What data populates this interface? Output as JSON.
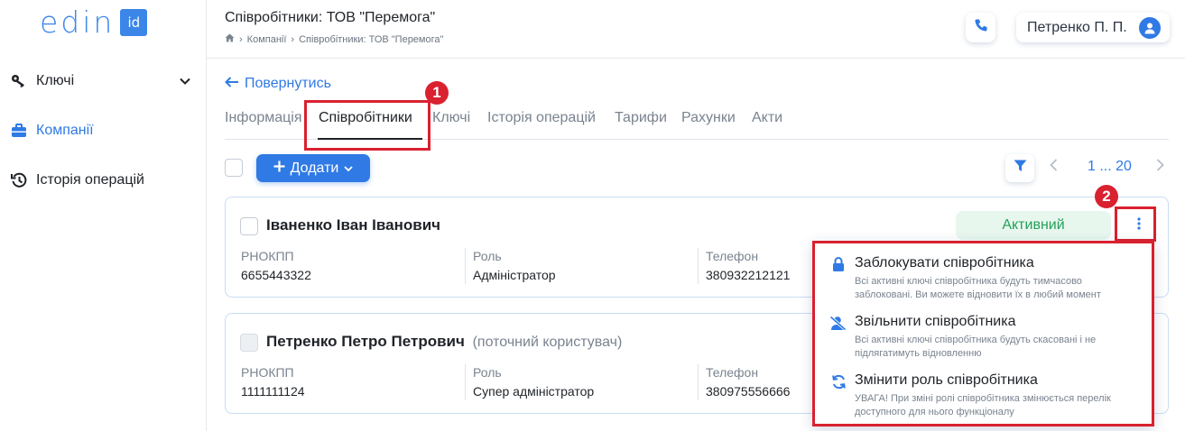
{
  "logo": {
    "text": "edin",
    "badge": "id"
  },
  "sidebar": {
    "items": [
      {
        "label": "Ключі",
        "icon": "key-icon"
      },
      {
        "label": "Компанії",
        "icon": "briefcase-icon"
      },
      {
        "label": "Історія операцій",
        "icon": "history-icon"
      }
    ]
  },
  "header": {
    "title": "Співробітники: ТОВ \"Перемога\"",
    "breadcrumb": [
      "Компанії",
      "Співробітники: ТОВ \"Перемога\""
    ],
    "user_name": "Петренко П. П."
  },
  "main": {
    "back_label": "Повернутись",
    "tabs": [
      "Інформація",
      "Співробітники",
      "Ключі",
      "Історія операцій",
      "Тарифи",
      "Рахунки",
      "Акти"
    ],
    "add_label": "Додати",
    "pager": "1 ... 20"
  },
  "employees": [
    {
      "name": "Іваненко Іван Іванович",
      "note": "",
      "status": "Активний",
      "fields": [
        {
          "label": "РНОКПП",
          "value": "6655443322"
        },
        {
          "label": "Роль",
          "value": "Адміністратор"
        },
        {
          "label": "Телефон",
          "value": "380932212121"
        }
      ]
    },
    {
      "name": "Петренко Петро Петрович",
      "note": "(поточний користувач)",
      "status": "",
      "fields": [
        {
          "label": "РНОКПП",
          "value": "1111111124"
        },
        {
          "label": "Роль",
          "value": "Супер адміністратор"
        },
        {
          "label": "Телефон",
          "value": "380975556666"
        }
      ]
    }
  ],
  "menu": {
    "items": [
      {
        "title": "Заблокувати співробітника",
        "desc": "Всі активні ключі співробітника будуть тимчасово заблоковані. Ви можете відновити їх в любий момент",
        "icon": "lock-icon"
      },
      {
        "title": "Звільнити співробітника",
        "desc": "Всі активні ключі співробітника будуть скасовані і не підлягатимуть відновленню",
        "icon": "user-remove-icon"
      },
      {
        "title": "Змінити роль співробітника",
        "desc": "УВАГА! При зміні ролі співробітника змінюється перелік доступного для нього функціоналу",
        "icon": "refresh-icon"
      }
    ]
  },
  "annotations": {
    "marker1": "1",
    "marker2": "2"
  },
  "colors": {
    "accent": "#2f7ae5",
    "highlight": "#d9212f",
    "success": "#24a05a"
  }
}
